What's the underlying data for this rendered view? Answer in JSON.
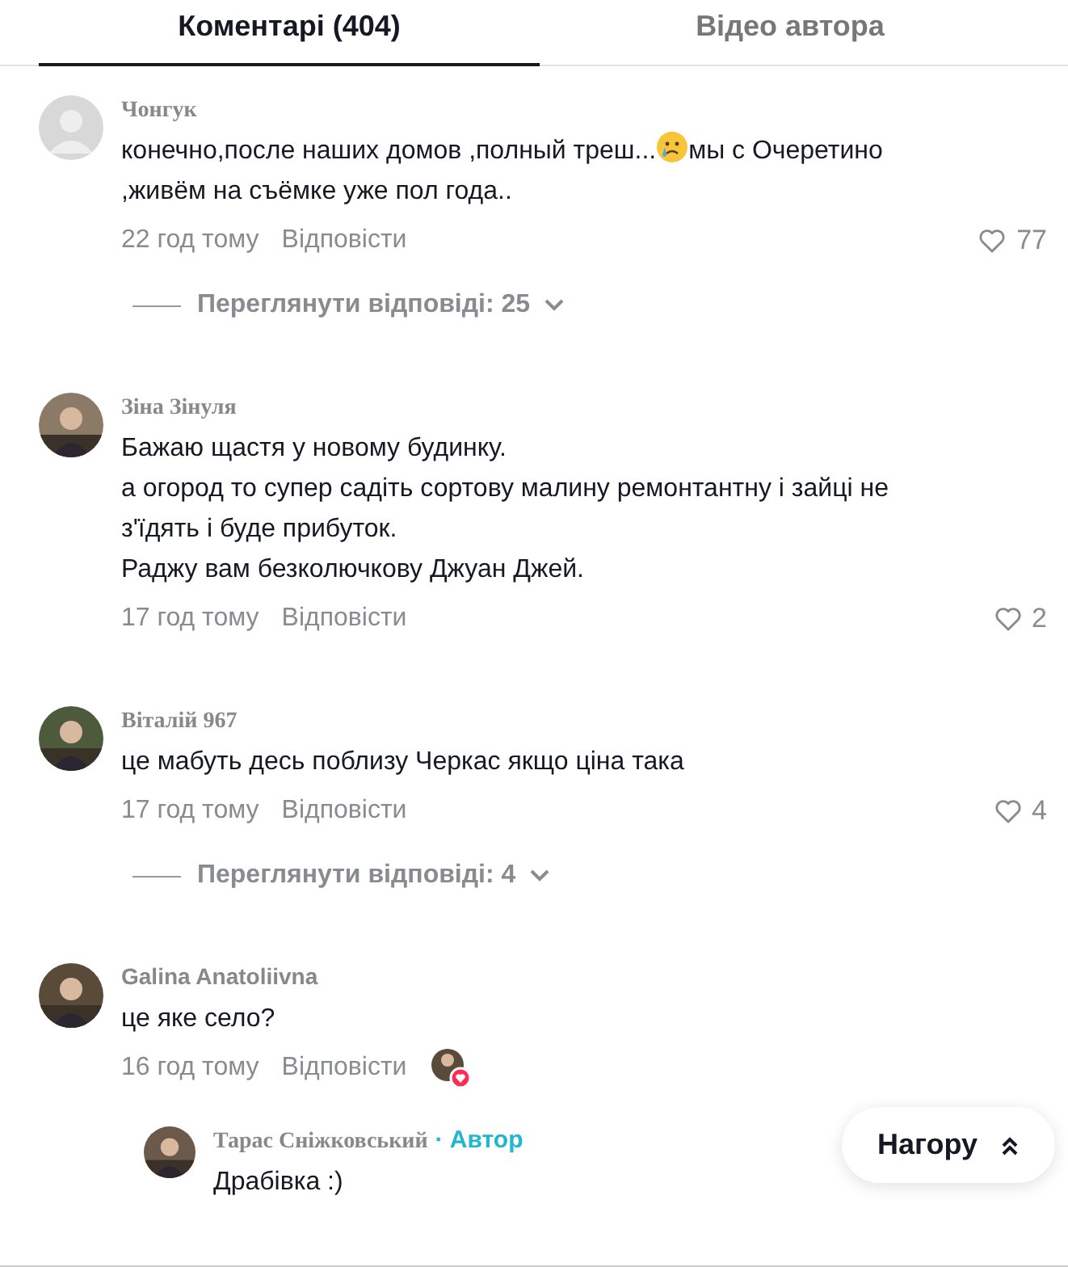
{
  "tabs": [
    {
      "label": "Коментарі (404)",
      "selected": true
    },
    {
      "label": "Відео автора",
      "selected": false
    }
  ],
  "comments": [
    {
      "avatar": {
        "kind": "default"
      },
      "name": "Чонгук",
      "kind": "serif",
      "body": [
        {
          "kind": "text",
          "text": "конечно,после наших домов ,полный треш..."
        },
        {
          "kind": "emoji"
        },
        {
          "kind": "text",
          "text": "мы с Очеретино ,живём на съёмке уже пол года.."
        }
      ],
      "time": "22 год тому",
      "reply": "Відповісти",
      "likes": "77",
      "replies": "Переглянути відповіді: 25"
    },
    {
      "avatar": {
        "kind": "picture"
      },
      "name": "Зіна Зінуля",
      "kind": "serif",
      "body": [
        {
          "kind": "text",
          "text": "Бажаю щастя у новому будинку.\nа огород то супер садіть сортову малину ремонтантну і зайці не з'їдять і буде прибуток.\nРаджу вам безколючкову Джуан Джей."
        }
      ],
      "time": "17 год тому",
      "reply": "Відповісти",
      "likes": "2"
    },
    {
      "avatar": {
        "kind": "picture"
      },
      "name": "Віталій 967",
      "kind": "serif",
      "body": [
        {
          "kind": "text",
          "text": "це мабуть десь поблизу Черкас якщо ціна така"
        }
      ],
      "time": "17 год тому",
      "reply": "Відповісти",
      "likes": "4",
      "replies": "Переглянути відповіді: 4"
    },
    {
      "avatar": {
        "kind": "picture"
      },
      "name": "Galina Anatoliivna",
      "kind": "sans",
      "body": [
        {
          "kind": "text",
          "text": "це яке село?"
        }
      ],
      "time": "16 год тому",
      "reply": "Відповісти",
      "author_liked": true,
      "thread": [
        {
          "avatar": {
            "kind": "picture"
          },
          "name": "Тарас Сніжковський",
          "kind": "serif",
          "badge": "· Автор",
          "body": [
            {
              "kind": "text",
              "text": "Драбівка :)"
            }
          ]
        }
      ]
    }
  ],
  "top_button": "Нагору"
}
